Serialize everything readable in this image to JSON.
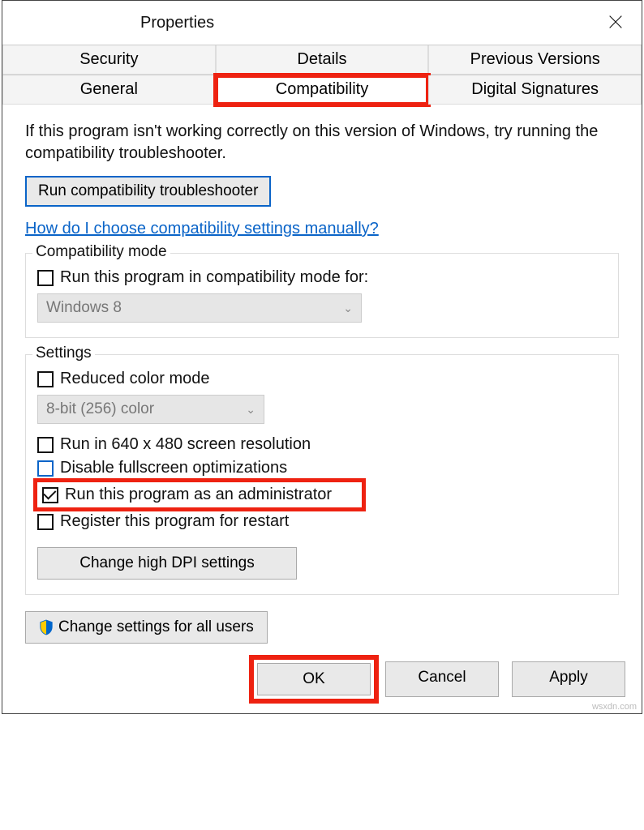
{
  "title": "Properties",
  "tabs": {
    "row1": [
      "Security",
      "Details",
      "Previous Versions"
    ],
    "row2": [
      "General",
      "Compatibility",
      "Digital Signatures"
    ]
  },
  "intro": "If this program isn't working correctly on this version of Windows, try running the compatibility troubleshooter.",
  "troubleshooter_btn": "Run compatibility troubleshooter",
  "manual_link": "How do I choose compatibility settings manually?",
  "compat_mode": {
    "legend": "Compatibility mode",
    "checkbox": "Run this program in compatibility mode for:",
    "select": "Windows 8"
  },
  "settings": {
    "legend": "Settings",
    "reduced_color": "Reduced color mode",
    "color_select": "8-bit (256) color",
    "low_res": "Run in 640 x 480 screen resolution",
    "disable_fs": "Disable fullscreen optimizations",
    "run_admin": "Run this program as an administrator",
    "register_restart": "Register this program for restart",
    "dpi_btn": "Change high DPI settings"
  },
  "all_users_btn": "Change settings for all users",
  "footer": {
    "ok": "OK",
    "cancel": "Cancel",
    "apply": "Apply"
  },
  "watermark": "wsxdn.com"
}
